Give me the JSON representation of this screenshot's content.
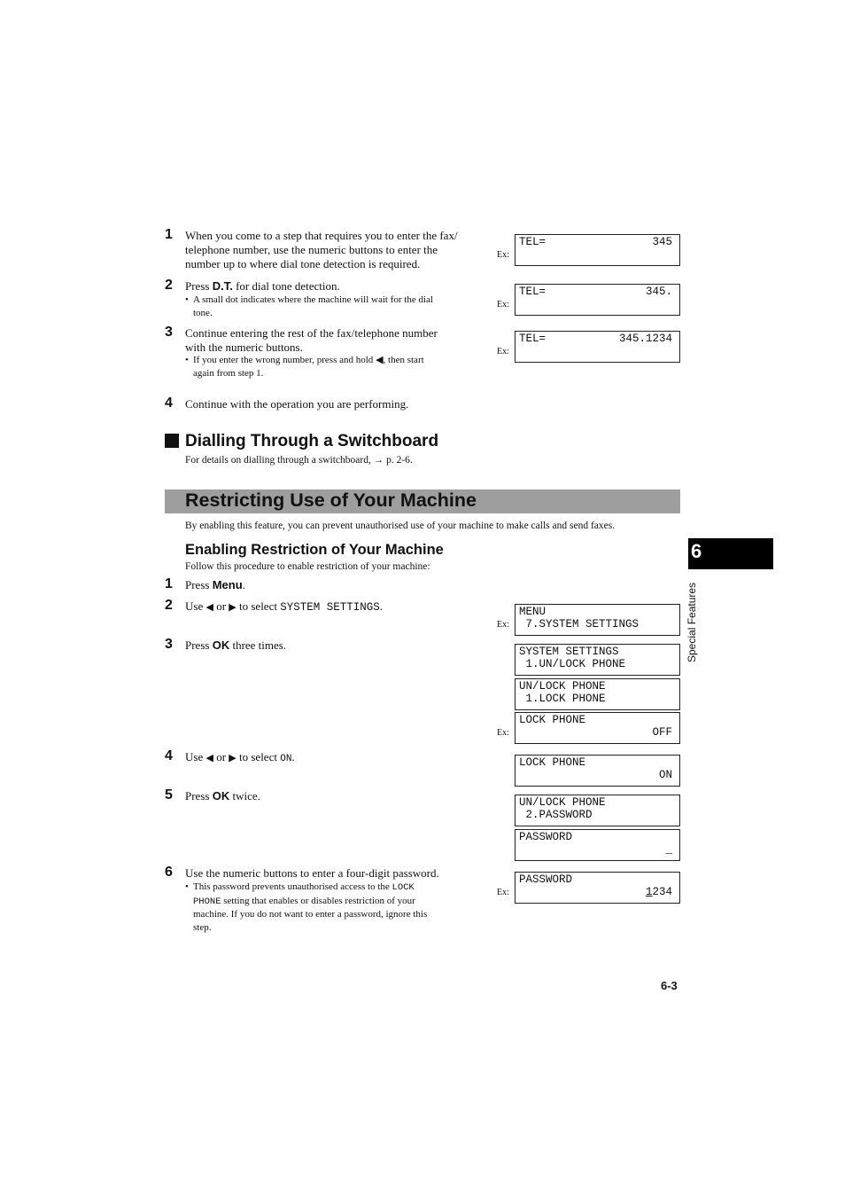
{
  "section1": {
    "steps": [
      {
        "num": "1",
        "lines": [
          "When you come to a step that requires you to enter the fax/",
          "telephone number, use the numeric buttons to enter the",
          "number up to where dial tone detection is required."
        ]
      },
      {
        "num": "2",
        "pre": "Press ",
        "key": "D.T.",
        "post": " for dial tone detection.",
        "bullet": [
          "A small dot indicates where the machine will wait for the dial",
          "tone."
        ]
      },
      {
        "num": "3",
        "lines": [
          "Continue entering the rest of the fax/telephone number",
          "with the numeric buttons."
        ],
        "bullet_pre": "If you enter the wrong number, press and hold ",
        "bullet_icon": "◀",
        "bullet_post": ", then start",
        "bullet_line2": "again from step 1."
      },
      {
        "num": "4",
        "text": "Continue with the operation you are performing."
      }
    ],
    "displays": [
      {
        "ex": "Ex:",
        "l1": "TEL=",
        "r1": "345"
      },
      {
        "ex": "Ex:",
        "l1": "TEL=",
        "r1": "345."
      },
      {
        "ex": "Ex:",
        "l1": "TEL=",
        "r1": "345.1234"
      }
    ]
  },
  "switchboard": {
    "heading": "Dialling Through a Switchboard",
    "text": "For details on dialling through a switchboard, → p. 2-6."
  },
  "restrict": {
    "banner": "Restricting Use of Your Machine",
    "intro": "By enabling this feature, you can prevent unauthorised use of your machine to make calls and send faxes.",
    "subheading": "Enabling Restriction of Your Machine",
    "subintro": "Follow this procedure to enable restriction of your machine:",
    "steps": [
      {
        "num": "1",
        "pre": "Press ",
        "key": "Menu",
        "post": "."
      },
      {
        "num": "2",
        "pre": "Use ",
        "left": "◀",
        "or": " or ",
        "right": "▶",
        "mid": " to select ",
        "code": "SYSTEM SETTINGS",
        "post": "."
      },
      {
        "num": "3",
        "pre": "Press ",
        "key": "OK",
        "post": " three times."
      },
      {
        "num": "4",
        "pre": "Use ",
        "left": "◀",
        "or": " or ",
        "right": "▶",
        "mid": " to select ",
        "code": "ON",
        "post": "."
      },
      {
        "num": "5",
        "pre": "Press ",
        "key": "OK",
        "post": " twice."
      },
      {
        "num": "6",
        "text": "Use the numeric buttons to enter a four-digit password.",
        "bullet": {
          "pre": "This password prevents unauthorised access to the ",
          "code1": "LOCK",
          "code2": "PHONE",
          "post1": " setting that enables or disables restriction of your",
          "line3": "machine. If you do not want to enter a password, ignore this",
          "line4": "step."
        }
      }
    ],
    "displays": [
      {
        "ex": "Ex:",
        "l1": "MENU",
        "l2": " 7.SYSTEM SETTINGS"
      },
      {
        "ex": "",
        "l1": "SYSTEM SETTINGS",
        "l2": " 1.UN/LOCK PHONE"
      },
      {
        "ex": "",
        "l1": "UN/LOCK PHONE",
        "l2": " 1.LOCK PHONE"
      },
      {
        "ex": "Ex:",
        "l1": "LOCK PHONE",
        "r2": "OFF"
      },
      {
        "ex": "",
        "l1": "LOCK PHONE",
        "r2": "ON"
      },
      {
        "ex": "",
        "l1": "UN/LOCK PHONE",
        "l2": " 2.PASSWORD"
      },
      {
        "ex": "",
        "l1": "PASSWORD",
        "r2": "_"
      },
      {
        "ex": "Ex:",
        "l1": "PASSWORD",
        "r2_first": "1",
        "r2_rest": "234"
      }
    ]
  },
  "side_tab": {
    "chapter": "6",
    "label": "Special Features"
  },
  "footer": {
    "page": "6-3"
  }
}
